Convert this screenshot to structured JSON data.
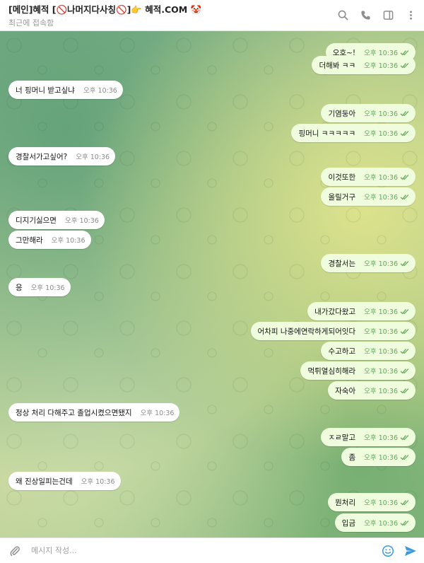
{
  "header": {
    "title": "[메인]혜적 [🚫나머지다사칭🚫]👉 혜적.COM 🤡",
    "status": "최근에 접속함",
    "icons": [
      "search-icon",
      "phone-icon",
      "sidebar-toggle-icon",
      "more-vertical-icon"
    ]
  },
  "messages": [
    {
      "dir": "out",
      "text": "오호~!",
      "time": "오후 10:36"
    },
    {
      "dir": "out",
      "text": "더해봐 ㅋㅋ",
      "time": "오후 10:36"
    },
    {
      "dir": "in",
      "text": "너 핑머니 받고싶냐",
      "time": "오후 10:36"
    },
    {
      "dir": "out",
      "text": "기염둥아",
      "time": "오후 10:36"
    },
    {
      "dir": "out",
      "text": "핑머니 ㅋㅋㅋㅋㅋ",
      "time": "오후 10:36"
    },
    {
      "dir": "in",
      "text": "경찰서가고싶어?",
      "time": "오후 10:36"
    },
    {
      "dir": "out",
      "text": "이것또한",
      "time": "오후 10:36"
    },
    {
      "dir": "out",
      "text": "올릴거구",
      "time": "오후 10:36"
    },
    {
      "dir": "in",
      "text": "디지기싫으면",
      "time": "오후 10:36"
    },
    {
      "dir": "in",
      "text": "그만해라",
      "time": "오후 10:36"
    },
    {
      "dir": "out",
      "text": "경찰서는",
      "time": "오후 10:36"
    },
    {
      "dir": "in",
      "text": "응",
      "time": "오후 10:36"
    },
    {
      "dir": "out",
      "text": "내가갔다왔고",
      "time": "오후 10:36"
    },
    {
      "dir": "out",
      "text": "어차피 나중에연락하게되어잇다",
      "time": "오후 10:36"
    },
    {
      "dir": "out",
      "text": "수고하고",
      "time": "오후 10:36"
    },
    {
      "dir": "out",
      "text": "먹튀열심히해라",
      "time": "오후 10:36"
    },
    {
      "dir": "out",
      "text": "자숙아",
      "time": "오후 10:36"
    },
    {
      "dir": "in",
      "text": "정상 처리 다해주고 졸업시켰으면됐지",
      "time": "오후 10:36"
    },
    {
      "dir": "out",
      "text": "ㅈㄹ말고",
      "time": "오후 10:36"
    },
    {
      "dir": "out",
      "text": "좀",
      "time": "오후 10:36"
    },
    {
      "dir": "in",
      "text": "왜 진상일피는건데",
      "time": "오후 10:36"
    },
    {
      "dir": "out",
      "text": "뭔처리",
      "time": "오후 10:36"
    },
    {
      "dir": "out",
      "text": "입금",
      "time": "오후 10:36"
    }
  ],
  "composer": {
    "placeholder": "메시지 작성...",
    "value": ""
  },
  "colors": {
    "incoming_bubble": "#ffffff",
    "outgoing_bubble": "#effdde",
    "outgoing_time": "#62a85c",
    "send_accent": "#3a9bdc"
  }
}
